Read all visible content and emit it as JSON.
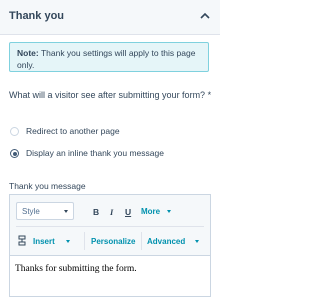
{
  "header": {
    "title": "Thank you"
  },
  "note": {
    "prefix": "Note:",
    "text": " Thank you settings will apply to this page only."
  },
  "question": {
    "text": "What will a visitor see after submitting your form? *"
  },
  "options": [
    {
      "label": "Redirect to another page",
      "selected": false
    },
    {
      "label": "Display an inline thank you message",
      "selected": true
    }
  ],
  "message_field": {
    "label": "Thank you message",
    "toolbar": {
      "style_value": "Style",
      "bold": "B",
      "italic": "I",
      "underline": "U",
      "more": "More",
      "insert": "Insert",
      "personalize": "Personalize",
      "advanced": "Advanced"
    },
    "content": "Thanks for submitting the form."
  },
  "colors": {
    "accent": "#0091ae",
    "text": "#33475b",
    "note_bg": "#e5f5f8",
    "note_border": "#7fd1de"
  },
  "icons": {
    "collapse": "chevron-up-icon",
    "embed": "embed-icon"
  }
}
